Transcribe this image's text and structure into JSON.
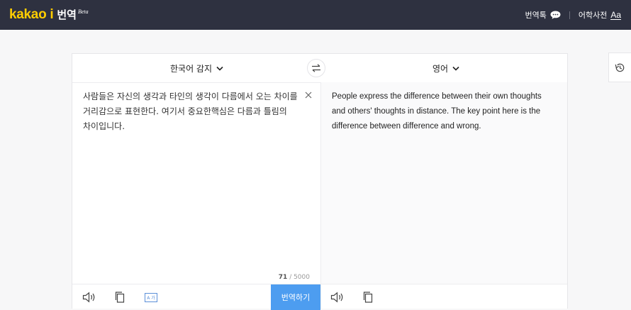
{
  "header": {
    "brand": "kakao i",
    "product": "번역",
    "beta": "Beta",
    "talk_label": "번역톡",
    "dictionary_label": "어학사전",
    "dictionary_icon_text": "Aa"
  },
  "languages": {
    "source": "한국어 감지",
    "target": "영어"
  },
  "source": {
    "text": "사람들은 자신의 생각과 타인의 생각이 다름에서 오는 차이를 거리감으로 표현한다. 여기서 중요한핵심은 다름과 틀림의 차이입니다.",
    "count": "71",
    "max": "/ 5000"
  },
  "target": {
    "text": "People express the difference between their own thoughts and others' thoughts in distance. The key point here is the difference between difference and wrong."
  },
  "toolbar": {
    "font_icon_text": "A 가",
    "translate_label": "번역하기"
  },
  "icons": {
    "chat": "chat-bubble-icon",
    "swap": "swap-icon",
    "clear": "close-icon",
    "speaker": "speaker-icon",
    "copy": "copy-icon",
    "history": "history-icon"
  },
  "colors": {
    "header_bg": "#2e3140",
    "brand_yellow": "#ffcd00",
    "accent_blue": "#4d9df0"
  }
}
